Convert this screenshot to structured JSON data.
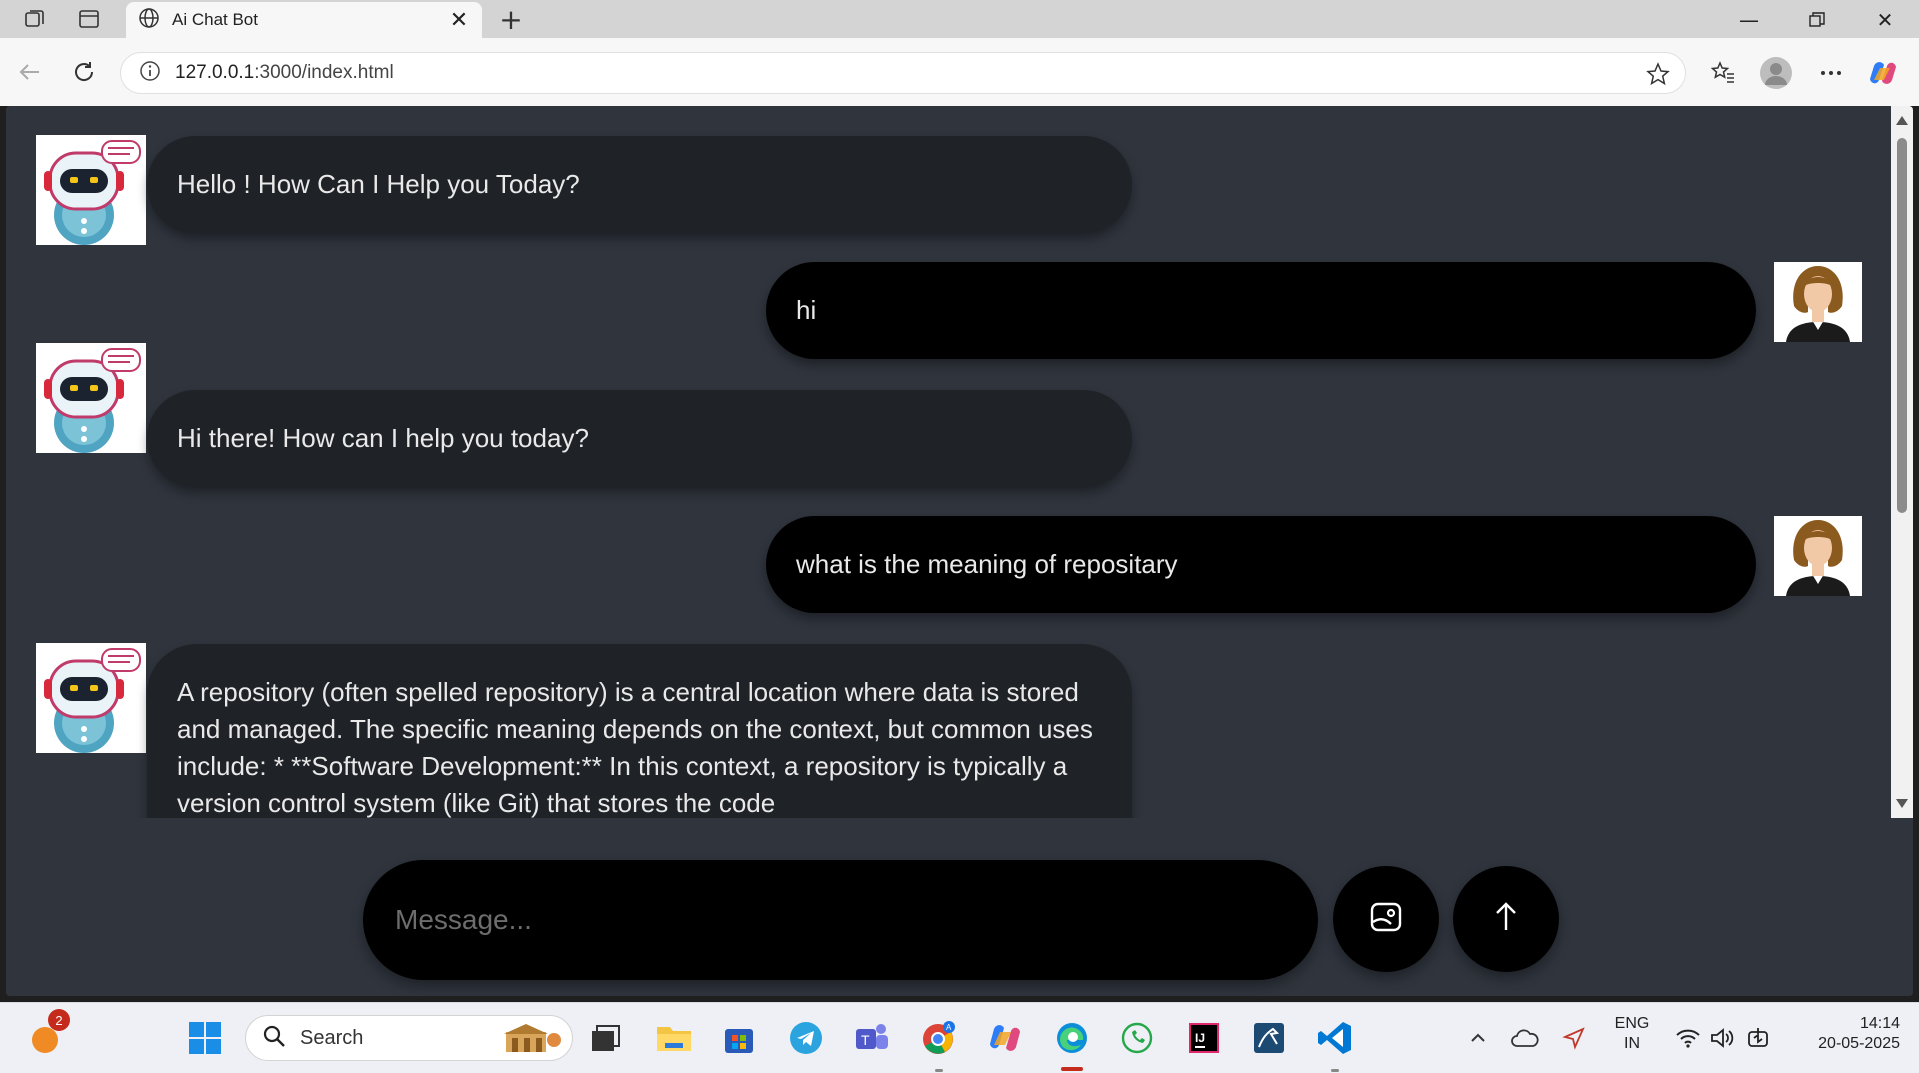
{
  "browser": {
    "tab_title": "Ai Chat Bot",
    "url_host": "127.0.0.1",
    "url_rest": ":3000/index.html"
  },
  "chat": {
    "messages": [
      {
        "role": "bot",
        "text": "Hello ! How Can I Help you Today?"
      },
      {
        "role": "user",
        "text": "hi"
      },
      {
        "role": "bot",
        "text": "Hi there! How can I help you today?"
      },
      {
        "role": "user",
        "text": "what is the meaning of repositary"
      },
      {
        "role": "bot",
        "text": "A repository (often spelled repository) is a central location where data is stored and managed. The specific meaning depends on the context, but common uses include: * **Software Development:** In this context, a repository is typically a version control system (like Git) that stores the code"
      }
    ]
  },
  "composer": {
    "placeholder": "Message..."
  },
  "taskbar": {
    "search_label": "Search",
    "notification_count": "2",
    "lang_line1": "ENG",
    "lang_line2": "IN",
    "time": "14:14",
    "date": "20-05-2025"
  },
  "colors": {
    "page_bg": "#2f343d",
    "bot_bubble": "#1f2226",
    "user_bubble": "#000000"
  }
}
